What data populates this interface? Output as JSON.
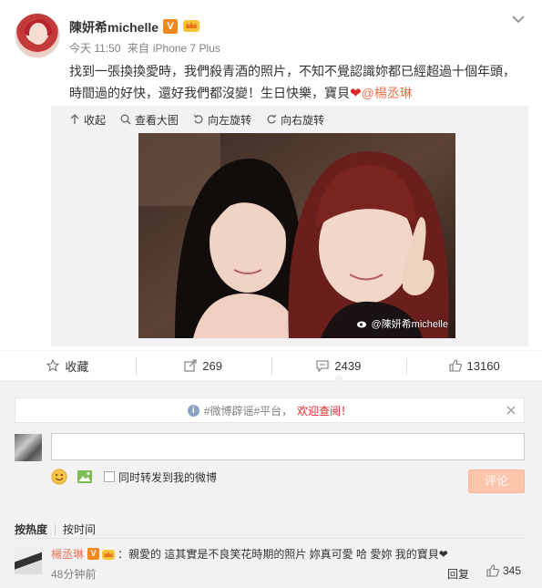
{
  "post": {
    "username": "陳妍希michelle",
    "verified_badge": "V",
    "time": "今天 11:50",
    "source_prefix": "来自",
    "source": "iPhone 7 Plus",
    "text_line1": "找到一張換換愛時，我們殺青酒的照片，不知不覺認識妳都已經超過十個年頭，",
    "text_line2_a": "時間過的好快，還好我們都沒變！生日快樂，寶貝",
    "heart": "❤",
    "mention": "@楊丞琳",
    "icons": {
      "menu": "chevron-down-icon",
      "crown": "crown-icon"
    }
  },
  "media": {
    "actions": [
      {
        "label": "收起",
        "icon": "collapse-icon"
      },
      {
        "label": "查看大图",
        "icon": "zoom-icon"
      },
      {
        "label": "向左旋转",
        "icon": "rotate-left-icon"
      },
      {
        "label": "向右旋转",
        "icon": "rotate-right-icon"
      }
    ],
    "watermark": "@陳妍希michelle"
  },
  "actions": {
    "favorite": "收藏",
    "repost": "269",
    "comment": "2439",
    "like": "13160"
  },
  "comments": {
    "notice_prefix": "#微博辟谣#平台，",
    "notice_highlight": "欢迎查阅！",
    "input_value": "",
    "repost_label": "同时转发到我的微博",
    "submit": "评论",
    "sort_hot": "按热度",
    "sort_time": "按时间",
    "items": [
      {
        "user": "楊丞琳",
        "badge": "V",
        "text": "：親愛的 這其實是不良笑花時期的照片 妳真可愛 哈 愛妳 我的寶貝❤",
        "time": "48分钟前",
        "reply": "回复",
        "likes": "345"
      }
    ]
  },
  "colors": {
    "accent": "#eb7350",
    "vbadge": "#f08a1c",
    "heart": "#e0282c",
    "bg_grey": "#f2f2f5"
  }
}
